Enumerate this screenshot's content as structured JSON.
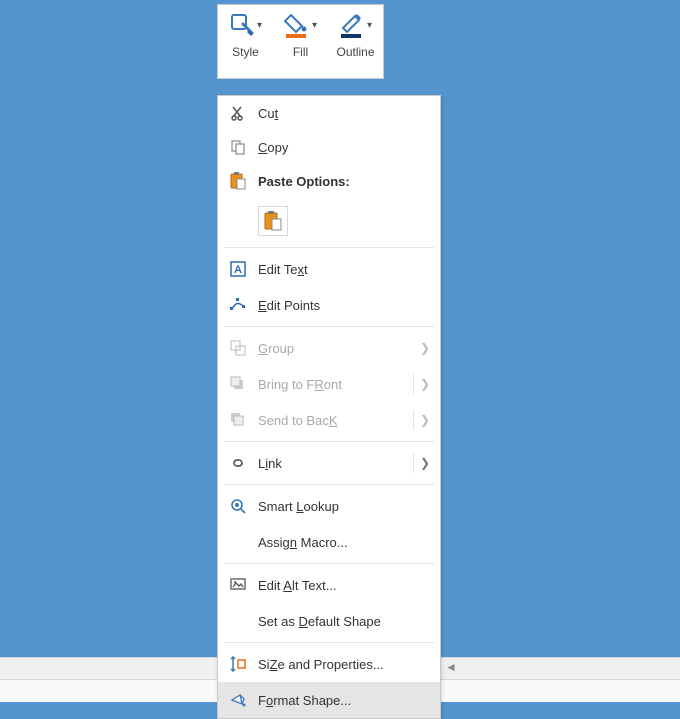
{
  "toolbar": {
    "style": "Style",
    "fill": "Fill",
    "outline": "Outline"
  },
  "menu": {
    "cut": "Cut",
    "copy": "Copy",
    "paste_options": "Paste Options:",
    "edit_text": "Edit Text",
    "edit_points": "Edit Points",
    "group": "Group",
    "bring_front": "Bring to Front",
    "send_back": "Send to Back",
    "link": "Link",
    "smart_lookup": "Smart Lookup",
    "assign_macro": "Assign Macro...",
    "edit_alt": "Edit Alt Text...",
    "default_shape": "Set as Default Shape",
    "size_props": "Size and Properties...",
    "format_shape": "Format Shape..."
  },
  "accel": {
    "cut": "t",
    "copy": "C",
    "edit_text": "x",
    "edit_points": "E",
    "group": "G",
    "bring_front": "R",
    "send_back": "K",
    "link": "i",
    "smart_lookup": "L",
    "assign_macro": "n",
    "edit_alt": "A",
    "default_shape": "D",
    "size_props": "Z",
    "format_shape": "o"
  }
}
